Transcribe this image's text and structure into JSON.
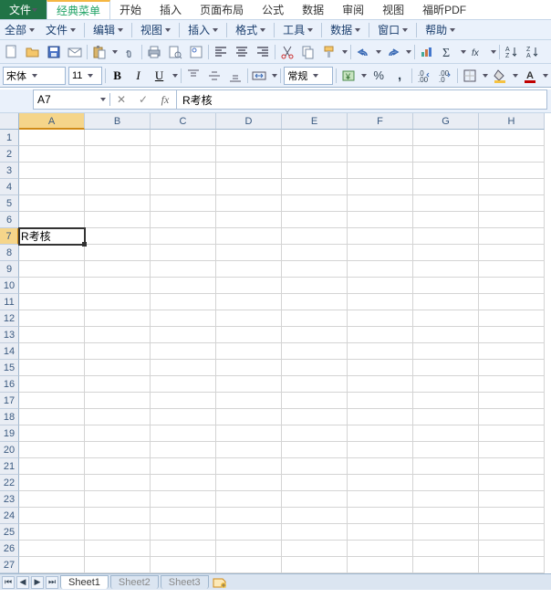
{
  "tabs": {
    "file": "文件",
    "active": "经典菜单",
    "items": [
      "开始",
      "插入",
      "页面布局",
      "公式",
      "数据",
      "审阅",
      "视图",
      "福昕PDF"
    ]
  },
  "menus": [
    "全部",
    "文件",
    "编辑",
    "视图",
    "插入",
    "格式",
    "工具",
    "数据",
    "窗口",
    "帮助"
  ],
  "font": {
    "name": "宋体",
    "size": "11"
  },
  "style_combo": "常规",
  "namebox": "A7",
  "formula": "R考核",
  "columns": [
    "A",
    "B",
    "C",
    "D",
    "E",
    "F",
    "G",
    "H"
  ],
  "rows": [
    "1",
    "2",
    "3",
    "4",
    "5",
    "6",
    "7",
    "8",
    "9",
    "10",
    "11",
    "12",
    "13",
    "14",
    "15",
    "16",
    "17",
    "18",
    "19",
    "20",
    "21",
    "22",
    "23",
    "24",
    "25",
    "26",
    "27"
  ],
  "active_cell": {
    "row_index": 6,
    "col_index": 0
  },
  "cell_data": {
    "6": {
      "0": "R考核"
    }
  },
  "sheets": {
    "active": "Sheet1",
    "others": [
      "Sheet2",
      "Sheet3"
    ]
  }
}
